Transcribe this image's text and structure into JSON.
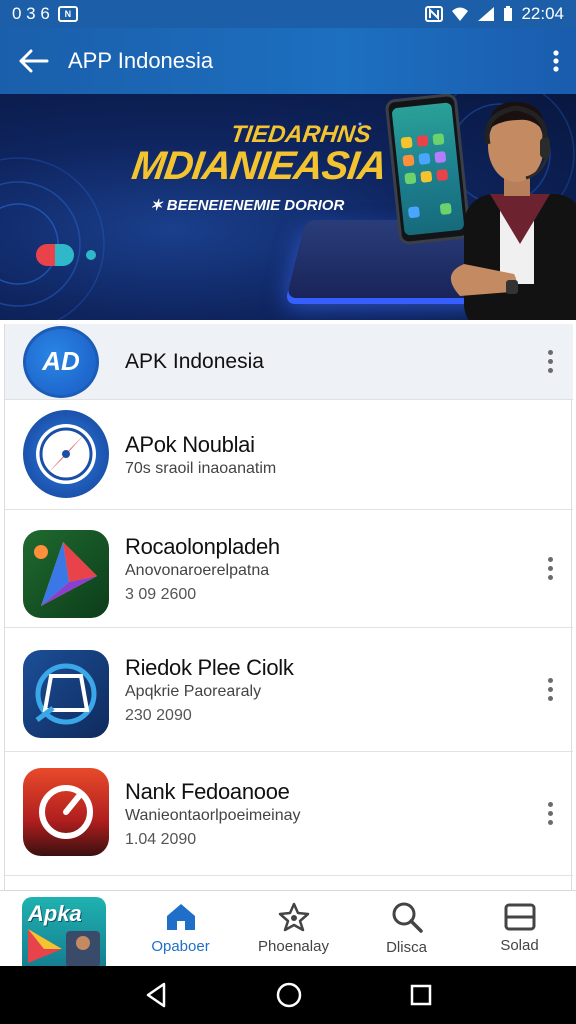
{
  "status_bar": {
    "left_text": "0 3 6",
    "badge": "N",
    "time": "22:04"
  },
  "app_bar": {
    "title": "APP Indonesia"
  },
  "banner": {
    "headline_line1": "TIEDARHNS",
    "headline_line2": "MDIANIEASIA",
    "subline": "BEENEIENEMIE DORIOR",
    "star": "✶",
    "colors": {
      "headline": "#f4c430",
      "background": "#0f2560"
    }
  },
  "list_header": {
    "icon_label": "AD",
    "title": "APK Indonesia"
  },
  "items": [
    {
      "title": "APok Noublai",
      "subtitle": "70s sraoil inaoanatim",
      "meta": "",
      "icon": "compass-icon"
    },
    {
      "title": "Rocaolonpladeh",
      "subtitle": "Anovonaroerelpatna",
      "meta": "3 09 2600",
      "icon": "prism-icon"
    },
    {
      "title": "Riedok Plee Ciolk",
      "subtitle": "Apqkrie Paorearaly",
      "meta": "230 2090",
      "icon": "frame-icon"
    },
    {
      "title": "Nank Fedoanooe",
      "subtitle": "Wanieontaorlpoeimeinay",
      "meta": "1.04 2090",
      "icon": "gauge-icon"
    }
  ],
  "bottom_nav": {
    "promo_label": "Apka",
    "items": [
      {
        "label": "Opaboer",
        "icon": "home-icon",
        "active": true
      },
      {
        "label": "Phoenalay",
        "icon": "star-icon",
        "active": false
      },
      {
        "label": "Dlisca",
        "icon": "search-icon",
        "active": false
      },
      {
        "label": "Solad",
        "icon": "storage-icon",
        "active": false
      }
    ]
  },
  "colors": {
    "primary": "#1d6fc0",
    "active_nav": "#1f6fc8",
    "system_nav": "#000000"
  }
}
